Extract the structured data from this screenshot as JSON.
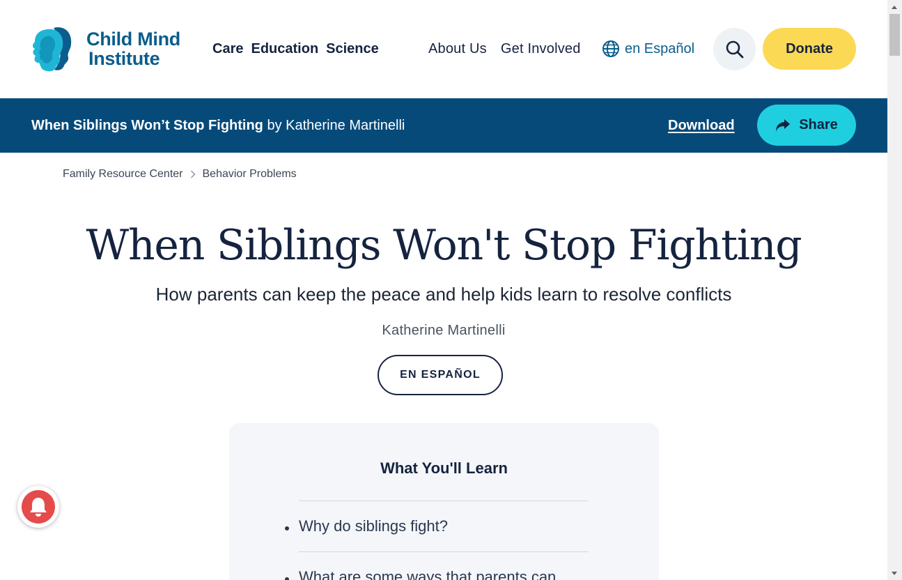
{
  "header": {
    "logo": {
      "line1": "Child Mind",
      "line2": "Institute"
    },
    "primary_nav": [
      "Care",
      "Education",
      "Science"
    ],
    "secondary_nav": [
      "About Us",
      "Get Involved"
    ],
    "language_link": "en Español",
    "donate_label": "Donate"
  },
  "article_bar": {
    "title": "When Siblings Won’t Stop Fighting",
    "byline": "by Katherine Martinelli",
    "download_label": "Download",
    "share_label": "Share"
  },
  "breadcrumb": [
    "Family Resource Center",
    "Behavior Problems"
  ],
  "article": {
    "title": "When Siblings Won't Stop Fighting",
    "subtitle": "How parents can keep the peace and help kids learn to resolve conflicts",
    "author": "Katherine Martinelli",
    "spanish_button": "EN ESPAÑOL"
  },
  "learn": {
    "heading": "What You'll Learn",
    "items": [
      "Why do siblings fight?",
      "What are some ways that parents can"
    ]
  },
  "colors": {
    "brand_blue": "#064a7a",
    "logo_blue": "#0a5d8c",
    "logo_cyan": "#1fb6d6",
    "donate_yellow": "#fcd954",
    "share_cyan": "#1fcfe0",
    "bell_red": "#e54b4b"
  },
  "icons": [
    "search-icon",
    "globe-icon",
    "share-arrow-icon",
    "bell-icon",
    "chevron-right-icon"
  ]
}
